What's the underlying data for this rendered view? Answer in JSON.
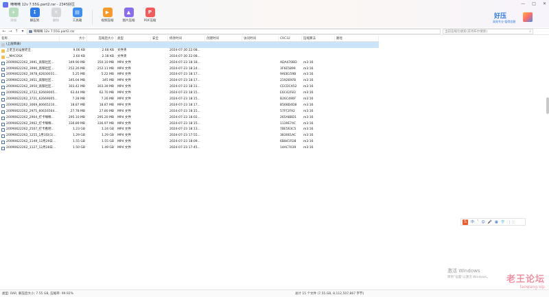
{
  "window": {
    "title": "嘀嘀嘀 12v 7.55G.part2.rar - 2345好压",
    "controls": [
      "—",
      "□",
      "✕"
    ]
  },
  "brand": {
    "title": "好压",
    "subtitle": "高效专业 值得信赖"
  },
  "toolbar": {
    "items": [
      {
        "label": "添加",
        "icon": "add-icon",
        "color": "#4caf50",
        "disabled": true
      },
      {
        "label": "解压到",
        "icon": "extract-icon",
        "color": "#2f7bea",
        "disabled": false
      },
      {
        "label": "删除",
        "icon": "delete-icon",
        "color": "#9e9e9e",
        "disabled": true
      },
      {
        "label": "工具箱",
        "icon": "toolbox-icon",
        "color": "#3f8ef0",
        "disabled": false
      },
      {
        "label": "视频压缩",
        "icon": "video-icon",
        "color": "#f59a2b",
        "disabled": false
      },
      {
        "label": "图片压缩",
        "icon": "image-icon",
        "color": "#8a6cf0",
        "disabled": false
      },
      {
        "label": "PDF压缩",
        "icon": "pdf-icon",
        "color": "#f25b5b",
        "disabled": false
      }
    ]
  },
  "address": {
    "nav": [
      "←",
      "→",
      "↑",
      "▾"
    ],
    "path": "嘀嘀嘀 12v 7.55G.part2.rar",
    "search_placeholder": "当前压缩包搜索(支持布尔搜索)"
  },
  "table": {
    "headers": [
      "名称",
      "大小",
      "压缩后大小",
      "类型",
      "安全",
      "修改时间",
      "创建时间",
      "访问时间",
      "CRC32",
      "压缩算法",
      "路径"
    ],
    "rows": [
      {
        "name": "(上层目录)",
        "icon": "up",
        "size": "",
        "csize": "",
        "type": "",
        "mod": "",
        "crc": "",
        "alg": "",
        "selected": true
      },
      {
        "name": "上老王论坛搜老王",
        "icon": "folder",
        "size": "9.06 KB",
        "csize": "2.68 KB",
        "type": "文件夹",
        "mod": "2024-07-30 22:08...",
        "crc": "",
        "alg": ""
      },
      {
        "name": "__MACOSX",
        "icon": "folder",
        "size": "2.60 KB",
        "csize": "2.18 KB",
        "type": "文件夹",
        "mod": "2024-07-30 22:08...",
        "crc": "",
        "alg": ""
      },
      {
        "name": "20090622262_3991_高铁社区...",
        "icon": "file",
        "size": "349.90 MB",
        "csize": "350.10 MB",
        "type": "MP4 文件",
        "mod": "2024-07-23 18:18...",
        "crc": "ADA470BD",
        "alg": "m3:16"
      },
      {
        "name": "20090622262_3990_高铁社区...",
        "icon": "file",
        "size": "252.26 MB",
        "csize": "252.11 MB",
        "type": "MP4 文件",
        "mod": "2024-07-23 18:24...",
        "crc": "3F6E5899",
        "alg": "m3:16"
      },
      {
        "name": "20090622262_3978_62830031...",
        "icon": "file",
        "size": "5.25 MB",
        "csize": "5.22 MB",
        "type": "MP4 文件",
        "mod": "2024-07-23 18:17...",
        "crc": "9AE8159B",
        "alg": "m3:16"
      },
      {
        "name": "20090622262_3951_高铁社区...",
        "icon": "file",
        "size": "345.04 MB",
        "csize": "345 MB",
        "type": "MP4 文件",
        "mod": "2024-07-23 18:17...",
        "crc": "2192697B",
        "alg": "m3:16"
      },
      {
        "name": "20090622262_3950_高铁社区...",
        "icon": "file",
        "size": "303.42 MB",
        "csize": "303.39 MB",
        "type": "MP4 文件",
        "mod": "2024-07-23 18:31...",
        "crc": "CECDCA52",
        "alg": "m3:16"
      },
      {
        "name": "20090622262_3722_62669005...",
        "icon": "file",
        "size": "63.44 MB",
        "csize": "62.70 MB",
        "type": "MP4 文件",
        "mod": "2024-07-23 18:15...",
        "crc": "E6C42F83",
        "alg": "m3:16"
      },
      {
        "name": "20090622262_3721_62669005...",
        "icon": "file",
        "size": "7.28 MB",
        "csize": "7.26 MB",
        "type": "MP4 文件",
        "mod": "2024-07-23 18:15...",
        "crc": "B26C490F",
        "alg": "m3:16"
      },
      {
        "name": "20090622262_3069_60665210...",
        "icon": "file",
        "size": "18.87 MB",
        "csize": "18.87 MB",
        "type": "MP4 文件",
        "mod": "2024-07-23 18:17...",
        "crc": "B568D4D8",
        "alg": "m3:16"
      },
      {
        "name": "20090622262_2975_60616564...",
        "icon": "file",
        "size": "27.78 MB",
        "csize": "27.80 MB",
        "type": "MP4 文件",
        "mod": "2024-07-23 18:15...",
        "crc": "57FF2FA2",
        "alg": "m3:16"
      },
      {
        "name": "20090622262_2904_打卡嘀嘀...",
        "icon": "file",
        "size": "295.10 MB",
        "csize": "295.20 MB",
        "type": "MP4 文件",
        "mod": "2024-07-23 18:02...",
        "crc": "265A8BD1",
        "alg": "m3:16"
      },
      {
        "name": "20090622262_2902_打卡嘀嘀...",
        "icon": "file",
        "size": "336.89 MB",
        "csize": "336.97 MB",
        "type": "MP4 文件",
        "mod": "2024-07-23 18:15...",
        "crc": "1139E74C",
        "alg": "m3:16"
      },
      {
        "name": "20090622262_2507_打卡看吧...",
        "icon": "file",
        "size": "1.23 GB",
        "csize": "1.24 GB",
        "type": "MP4 文件",
        "mod": "2024-07-23 18:13...",
        "crc": "7BE563C5",
        "alg": "m3:16"
      },
      {
        "name": "20090622262_1255_1月3日(1)...",
        "icon": "file",
        "size": "1.29 GB",
        "csize": "1.29 GB",
        "type": "MP4 文件",
        "mod": "2024-07-23 17:55...",
        "crc": "383061AC",
        "alg": "m3:16"
      },
      {
        "name": "20090622262_1149_12月29日...",
        "icon": "file",
        "size": "1.55 GB",
        "csize": "1.55 GB",
        "type": "MP4 文件",
        "mod": "2024-07-23 18:09...",
        "crc": "6B841FD8",
        "alg": "m3:16"
      },
      {
        "name": "20090622262_1127_12月28日...",
        "icon": "file",
        "size": "1.50 GB",
        "csize": "1.49 GB",
        "type": "MP4 文件",
        "mod": "2024-07-23 17:45...",
        "crc": "14AC7039",
        "alg": "m3:16"
      }
    ]
  },
  "ime": {
    "logo": "S",
    "items": [
      "中",
      "ˇ",
      "☺",
      "🎤",
      "▦",
      "👕",
      "⋮⋮"
    ]
  },
  "activation": {
    "title": "激活 Windows",
    "subtitle": "转到\"设置\"以激活 Windows。"
  },
  "watermark": {
    "title": "老王论坛",
    "url": "laowang.vip"
  },
  "status": {
    "left": "类型: RAR, 解压后大小: 7.55 GB, 压缩率: 99.92%",
    "right": "总计 15 个文件 (7.55 GB, 8,112,507,867 字节)"
  },
  "colors": {
    "accent": "#2f7bea",
    "selected_row": "#cce4f7",
    "watermark": "#f08fa0"
  }
}
